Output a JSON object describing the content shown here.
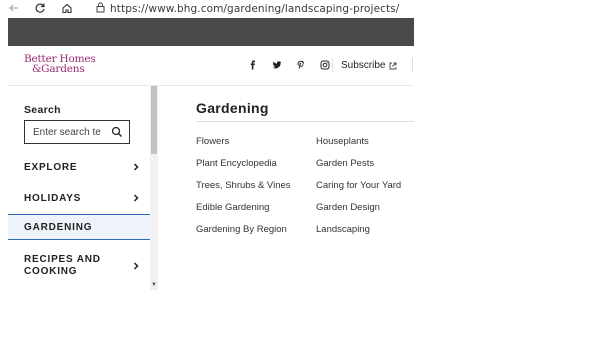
{
  "browser": {
    "url": "https://www.bhg.com/gardening/landscaping-projects/"
  },
  "site": {
    "logo_line1": "Better Homes",
    "logo_line2": "&Gardens",
    "subscribe_label": "Subscribe",
    "social": [
      "facebook-icon",
      "twitter-icon",
      "pinterest-icon",
      "instagram-icon"
    ]
  },
  "sidebar": {
    "search_label": "Search",
    "search_placeholder": "Enter search te",
    "items": [
      {
        "label": "EXPLORE",
        "has_chevron": true
      },
      {
        "label": "HOLIDAYS",
        "has_chevron": true
      },
      {
        "label": "GARDENING",
        "has_chevron": false,
        "active": true
      },
      {
        "label": "RECIPES AND COOKING",
        "has_chevron": true
      }
    ]
  },
  "main": {
    "title": "Gardening",
    "links_col1": [
      "Flowers",
      "Plant Encyclopedia",
      "Trees, Shrubs & Vines",
      "Edible Gardening",
      "Gardening By Region"
    ],
    "links_col2": [
      "Houseplants",
      "Garden Pests",
      "Caring for Your Yard",
      "Garden Design",
      "Landscaping"
    ]
  },
  "colors": {
    "brand": "#9b2d73",
    "topbar": "#4a4a4a",
    "active_border": "#2b6cb0",
    "active_bg": "#eef3fb"
  }
}
